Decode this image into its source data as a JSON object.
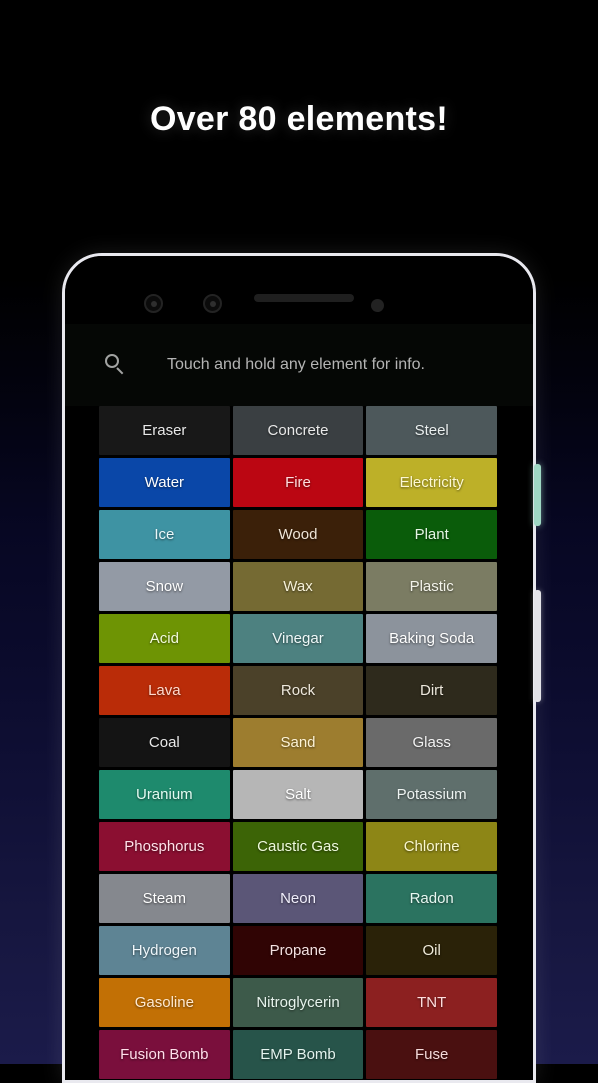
{
  "promo": {
    "headline": "Over 80 elements!",
    "background_top_color": "#000000",
    "background_bottom_color": "#1b1b4a"
  },
  "phone": {
    "frame_color": "#e9e9ef",
    "screen_color": "#000000",
    "sensors": [
      {
        "name": "front-camera-left"
      },
      {
        "name": "front-camera-right"
      }
    ],
    "speaker_label": "earpiece-speaker",
    "proximity_label": "proximity-sensor",
    "side_buttons": [
      {
        "name": "volume-button",
        "color": "#9fd8c4"
      },
      {
        "name": "power-button",
        "color": "#e3e3e8"
      }
    ]
  },
  "search": {
    "icon": "search-icon",
    "placeholder": "Touch and hold any element for info.",
    "value": ""
  },
  "grid": {
    "columns": 3,
    "elements": [
      {
        "label": "Eraser",
        "bg": "#181818",
        "fg": "#e8e8e8"
      },
      {
        "label": "Concrete",
        "bg": "#3a3f42",
        "fg": "#e9e9e9"
      },
      {
        "label": "Steel",
        "bg": "#4d585b",
        "fg": "#e9eeee"
      },
      {
        "label": "Water",
        "bg": "#0a47a8",
        "fg": "#ffffff"
      },
      {
        "label": "Fire",
        "bg": "#bb0612",
        "fg": "#ffdede"
      },
      {
        "label": "Electricity",
        "bg": "#bdb028",
        "fg": "#fdf8d2"
      },
      {
        "label": "Ice",
        "bg": "#3e93a3",
        "fg": "#eaf7fa"
      },
      {
        "label": "Wood",
        "bg": "#3b2009",
        "fg": "#f0e6d8"
      },
      {
        "label": "Plant",
        "bg": "#0a5c0a",
        "fg": "#e4f6e4"
      },
      {
        "label": "Snow",
        "bg": "#939aa5",
        "fg": "#ffffff"
      },
      {
        "label": "Wax",
        "bg": "#756a33",
        "fg": "#f6f1d8"
      },
      {
        "label": "Plastic",
        "bg": "#7b7c63",
        "fg": "#f3f3ea"
      },
      {
        "label": "Acid",
        "bg": "#6e9404",
        "fg": "#f2fadd"
      },
      {
        "label": "Vinegar",
        "bg": "#4d8180",
        "fg": "#eef8f8"
      },
      {
        "label": "Baking Soda",
        "bg": "#8c939c",
        "fg": "#ffffff"
      },
      {
        "label": "Lava",
        "bg": "#ba2c08",
        "fg": "#ffd9cc"
      },
      {
        "label": "Rock",
        "bg": "#4b4129",
        "fg": "#efe9dd"
      },
      {
        "label": "Dirt",
        "bg": "#2e2a1c",
        "fg": "#ece7db"
      },
      {
        "label": "Coal",
        "bg": "#141414",
        "fg": "#e8e8e8"
      },
      {
        "label": "Sand",
        "bg": "#9d7d2f",
        "fg": "#fdf3d6"
      },
      {
        "label": "Glass",
        "bg": "#6a6a6a",
        "fg": "#f2f2f2"
      },
      {
        "label": "Uranium",
        "bg": "#1e8a6d",
        "fg": "#e3fbf2"
      },
      {
        "label": "Salt",
        "bg": "#b6b6b6",
        "fg": "#ffffff"
      },
      {
        "label": "Potassium",
        "bg": "#5f6f6c",
        "fg": "#eef4f2"
      },
      {
        "label": "Phosphorus",
        "bg": "#8b0f31",
        "fg": "#ffe2e9"
      },
      {
        "label": "Caustic Gas",
        "bg": "#3c6406",
        "fg": "#eefadc"
      },
      {
        "label": "Chlorine",
        "bg": "#8d8616",
        "fg": "#faf7cf"
      },
      {
        "label": "Steam",
        "bg": "#85888e",
        "fg": "#ffffff"
      },
      {
        "label": "Neon",
        "bg": "#5b5677",
        "fg": "#f0eefb"
      },
      {
        "label": "Radon",
        "bg": "#2b7360",
        "fg": "#e6f7f1"
      },
      {
        "label": "Hydrogen",
        "bg": "#5e8494",
        "fg": "#eff7fb"
      },
      {
        "label": "Propane",
        "bg": "#300404",
        "fg": "#f4e1e1"
      },
      {
        "label": "Oil",
        "bg": "#2a2208",
        "fg": "#f1ecdb"
      },
      {
        "label": "Gasoline",
        "bg": "#c27005",
        "fg": "#ffe9cf"
      },
      {
        "label": "Nitroglycerin",
        "bg": "#3d5a4a",
        "fg": "#e8f4ee"
      },
      {
        "label": "TNT",
        "bg": "#8c2020",
        "fg": "#ffdede"
      },
      {
        "label": "Fusion Bomb",
        "bg": "#7a0f3c",
        "fg": "#ffdfea"
      },
      {
        "label": "EMP Bomb",
        "bg": "#27544a",
        "fg": "#e3f3ee"
      },
      {
        "label": "Fuse",
        "bg": "#4a1010",
        "fg": "#f5dada"
      }
    ]
  }
}
